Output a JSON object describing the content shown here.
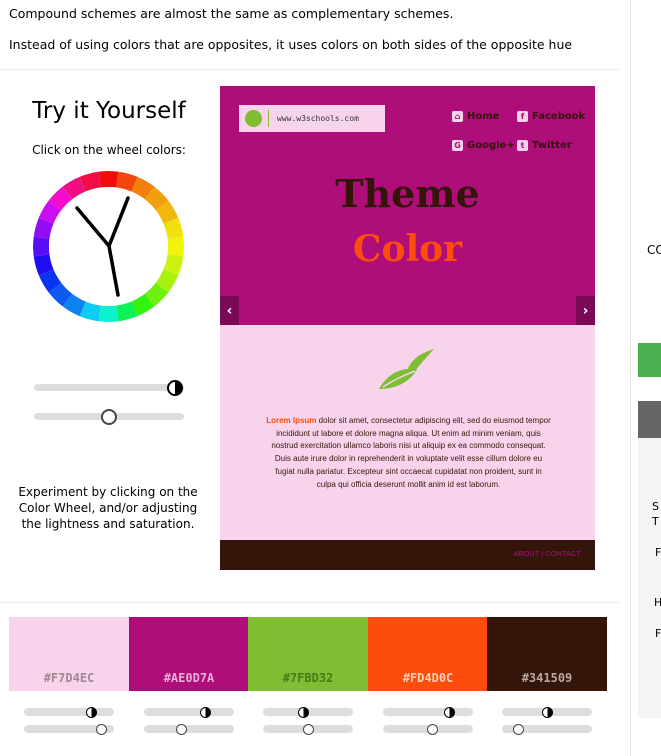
{
  "intro": {
    "line1": "Compound schemes are almost the same as complementary schemes.",
    "line2": "Instead of using colors that are opposites, it uses colors on both sides of the opposite hue"
  },
  "tryit": {
    "title": "Try it Yourself",
    "instruction": "Click on the wheel colors:",
    "experiment": "Experiment by clicking on the Color Wheel, and/or adjusting the lightness and saturation."
  },
  "demo": {
    "logo_url": "www.w3schools.com",
    "nav": {
      "home": "Home",
      "facebook": "Facebook",
      "google": "Google+",
      "twitter": "Twitter"
    },
    "headline1": "Theme",
    "headline2": "Color",
    "prev_arrow": "‹",
    "next_arrow": "›",
    "lorem_highlight": "Lorem Ipsum",
    "lorem_body": " dolor sit amet, consectetur adipiscing elit, sed do eiusmod tempor incididunt ut labore et dolore magna aliqua. Ut enim ad minim veniam, quis nostrud exercitation ullamco laboris nisi ut aliquip ex ea commodo consequat. Duis aute irure dolor in reprehenderit in voluptate velit esse cillum dolore eu fugiat nulla pariatur. Excepteur sint occaecat cupidatat non proident, sunt in culpa qui officia deserunt mollit anim id est laborum.",
    "footer_links": "ABOUT | CONTACT"
  },
  "swatches": [
    {
      "hex": "#F7D4EC",
      "color": "#F7D4EC",
      "label_color": "#a08890"
    },
    {
      "hex": "#AE0D7A",
      "color": "#AE0D7A",
      "label_color": "#e8b0d8"
    },
    {
      "hex": "#7FBD32",
      "color": "#7FBD32",
      "label_color": "#4a7a1a"
    },
    {
      "hex": "#FD4D0C",
      "color": "#FD4D0C",
      "label_color": "#ffd0b8"
    },
    {
      "hex": "#341509",
      "color": "#341509",
      "label_color": "#b8a8a0"
    }
  ],
  "edge": {
    "co": "CO",
    "s": "S",
    "t": "T",
    "r1": "F",
    "h": "H",
    "r2": "F"
  },
  "colors": {
    "primary": "#AE0D7A",
    "light": "#F7D4EC",
    "green": "#7FBD32",
    "orange": "#FD4D0C",
    "dark": "#341509"
  }
}
